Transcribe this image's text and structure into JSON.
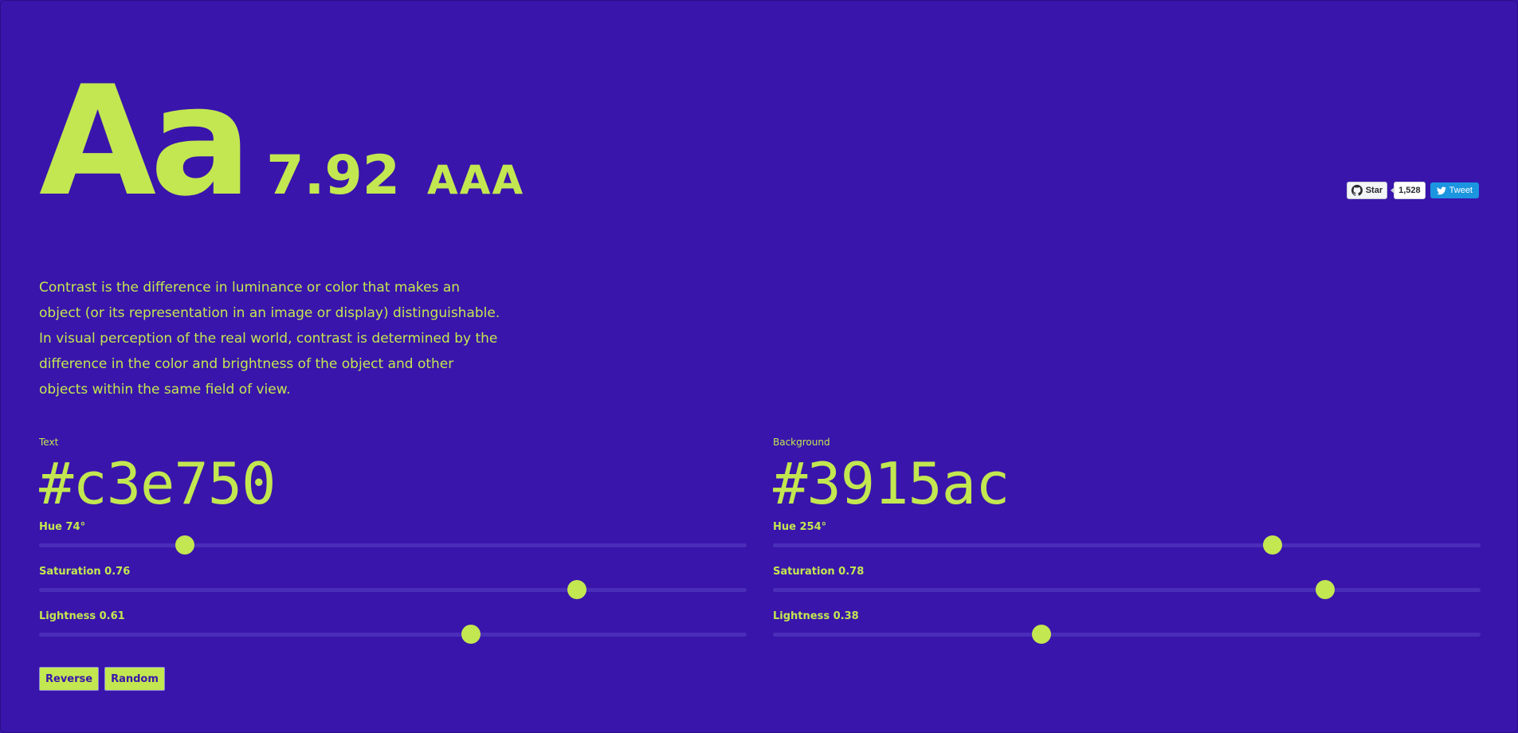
{
  "colors": {
    "text": "#c3e750",
    "background": "#3915ac",
    "tweet": "#1b95e0"
  },
  "hero": {
    "sample": "Aa",
    "ratio": "7.92",
    "rating": "AAA"
  },
  "badges": {
    "star_label": "Star",
    "star_count": "1,528",
    "tweet_label": "Tweet",
    "icons": [
      "github-icon",
      "twitter-icon"
    ]
  },
  "description": "Contrast is the difference in luminance or color that makes an object (or its representation in an image or display) distinguishable. In visual perception of the real world, contrast is determined by the difference in the color and brightness of the object and other objects within the same field of view.",
  "text_panel": {
    "label": "Text",
    "hex": "#c3e750",
    "hue_label": "Hue 74°",
    "hue": 74,
    "saturation_label": "Saturation 0.76",
    "saturation": 0.76,
    "lightness_label": "Lightness 0.61",
    "lightness": 0.61
  },
  "background_panel": {
    "label": "Background",
    "hex": "#3915ac",
    "hue_label": "Hue 254°",
    "hue": 254,
    "saturation_label": "Saturation 0.78",
    "saturation": 0.78,
    "lightness_label": "Lightness 0.38",
    "lightness": 0.38
  },
  "buttons": {
    "reverse": "Reverse",
    "random": "Random"
  }
}
